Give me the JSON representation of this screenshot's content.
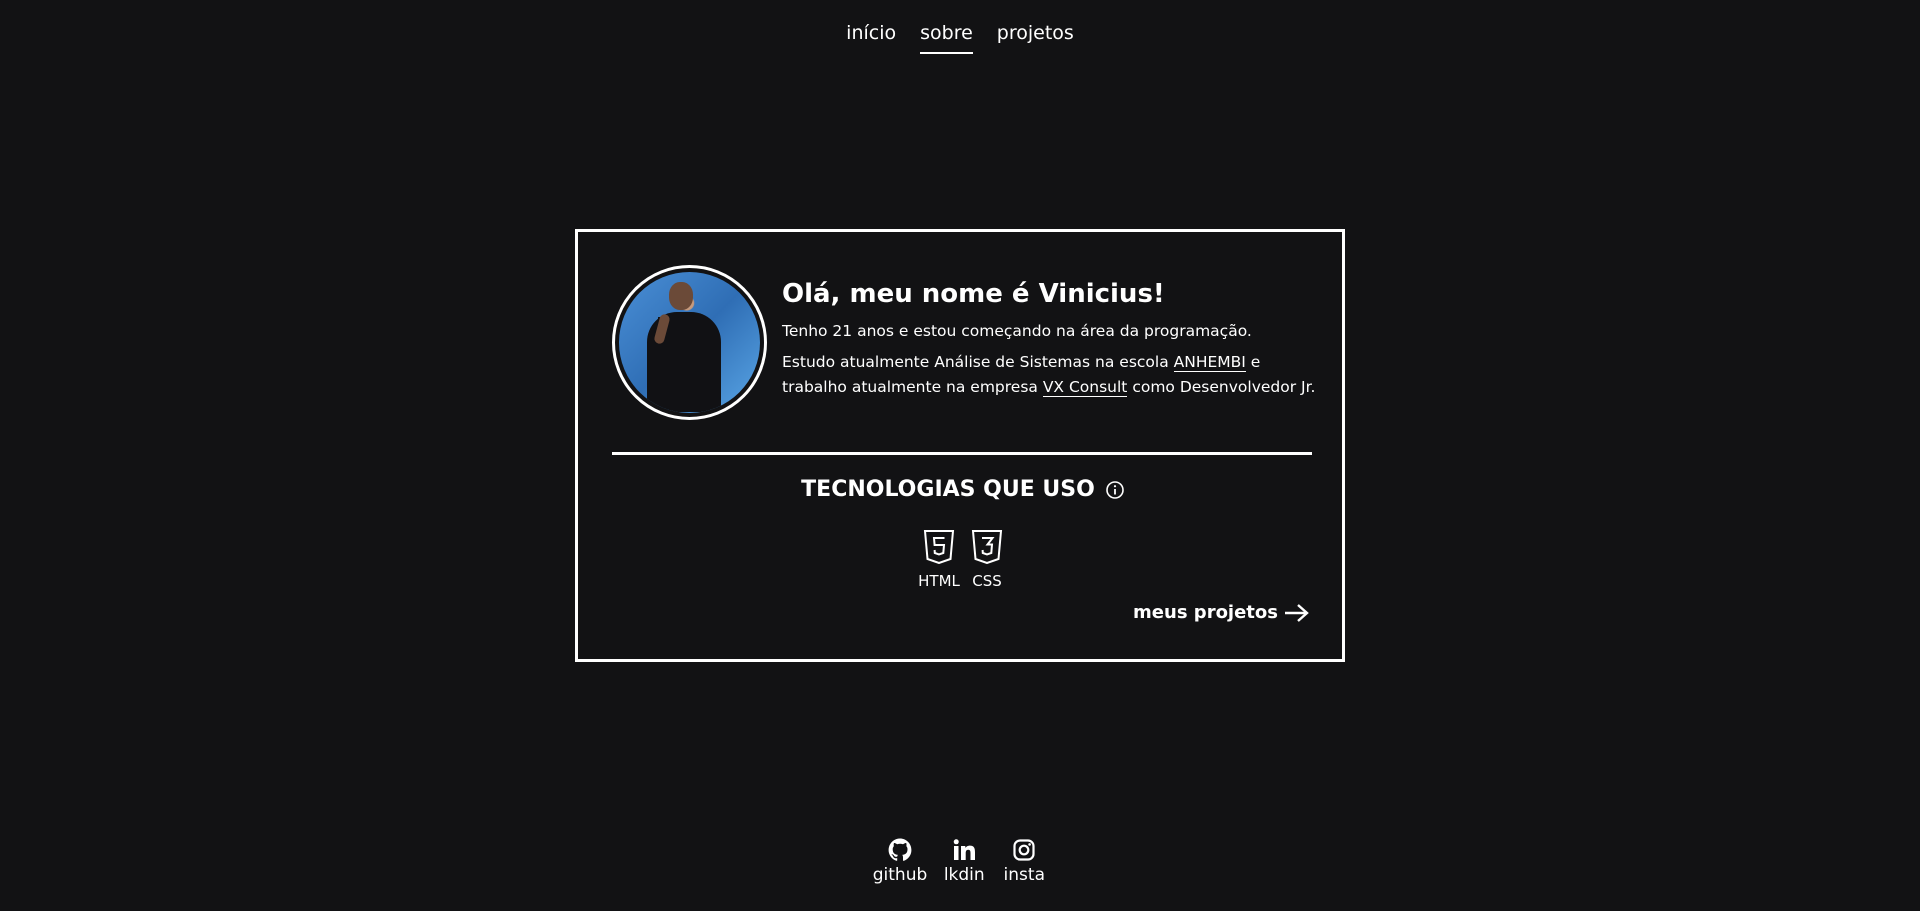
{
  "nav": {
    "items": [
      {
        "label": "início"
      },
      {
        "label": "sobre"
      },
      {
        "label": "projetos"
      }
    ]
  },
  "profile": {
    "greeting": "Olá, meu nome é Vinicius!",
    "line1": "Tenho 21 anos e estou começando na área da programação.",
    "line2_a": "Estudo atualmente Análise de Sistemas na escola ",
    "line2_school": "ANHEMBI",
    "line2_b": " e trabalho atualmente na empresa ",
    "line2_company": "VX Consult",
    "line2_c": " como Desenvolvedor Jr."
  },
  "tech": {
    "title": "TECNOLOGIAS QUE USO",
    "items": [
      {
        "label": "HTML",
        "icon": "html5-icon"
      },
      {
        "label": "CSS",
        "icon": "css3-icon"
      }
    ]
  },
  "projects_link": {
    "label": "meus projetos"
  },
  "footer": {
    "links": [
      {
        "label": "github",
        "icon": "github-icon"
      },
      {
        "label": "lkdin",
        "icon": "linkedin-icon"
      },
      {
        "label": "insta",
        "icon": "instagram-icon"
      }
    ]
  },
  "colors": {
    "background": "#121214",
    "foreground": "#ffffff"
  }
}
